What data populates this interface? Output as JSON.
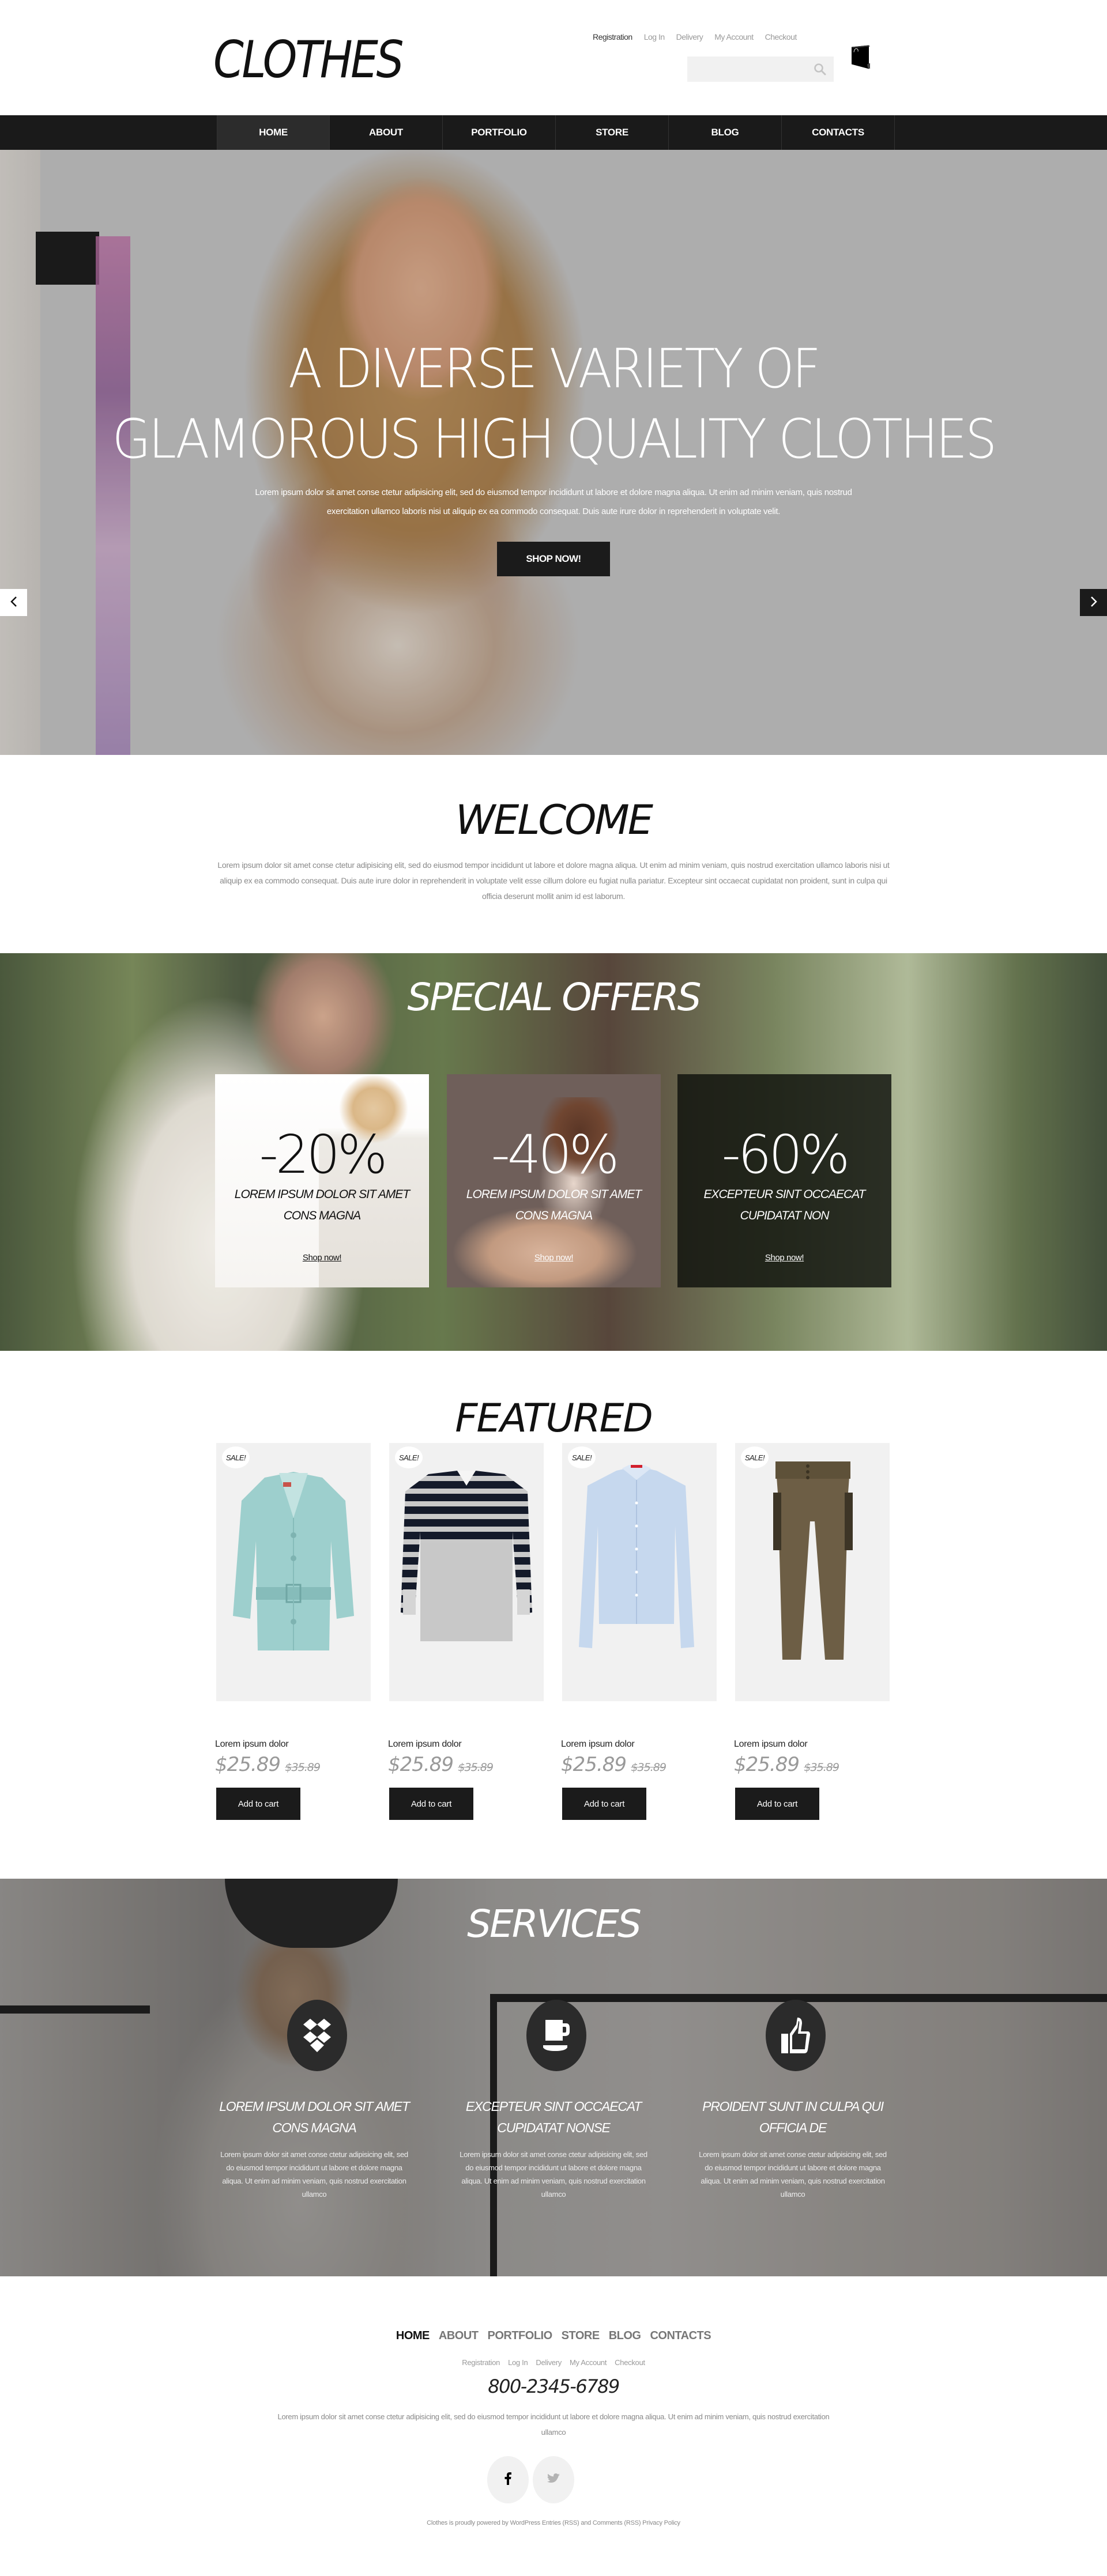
{
  "header": {
    "logo": "CLOTHES",
    "top_links": [
      "Registration",
      "Log In",
      "Delivery",
      "My Account",
      "Checkout"
    ],
    "search": {
      "placeholder": "",
      "value": "",
      "icon": "search-icon"
    },
    "cart_icon": "shopping-bag-icon"
  },
  "nav": {
    "items": [
      "HOME",
      "ABOUT",
      "PORTFOLIO",
      "STORE",
      "BLOG",
      "CONTACTS"
    ],
    "active": "HOME"
  },
  "hero": {
    "title_line1": "A DIVERSE VARIETY OF",
    "title_line2": "GLAMOROUS HIGH QUALITY CLOTHES",
    "text_line1": "Lorem ipsum dolor sit amet conse ctetur adipisicing elit, sed do eiusmod tempor incididunt ut labore et dolore magna aliqua. Ut enim ad minim veniam, quis nostrud",
    "text_line2": "exercitation ullamco laboris nisi ut aliquip ex ea commodo consequat. Duis aute irure dolor in reprehenderit in voluptate velit.",
    "button": "SHOP NOW!",
    "prev_icon": "chevron-left-icon",
    "next_icon": "chevron-right-icon"
  },
  "welcome": {
    "title": "WELCOME",
    "text": "Lorem ipsum dolor sit amet conse ctetur adipisicing elit, sed do eiusmod tempor incididunt ut labore et dolore magna aliqua. Ut enim ad minim veniam, quis nostrud exercitation ullamco laboris nisi ut aliquip ex ea commodo consequat. Duis aute irure dolor in reprehenderit in voluptate velit esse cillum dolore eu fugiat nulla pariatur. Excepteur sint occaecat cupidatat non proident, sunt in culpa qui officia deserunt mollit anim id est laborum."
  },
  "offers": {
    "title": "SPECIAL OFFERS",
    "cards": [
      {
        "percent": "-20%",
        "title": "LOREM IPSUM DOLOR SIT AMET CONS MAGNA",
        "link": "Shop now!"
      },
      {
        "percent": "-40%",
        "title": "LOREM IPSUM DOLOR SIT AMET CONS MAGNA",
        "link": "Shop now!"
      },
      {
        "percent": "-60%",
        "title": "EXCEPTEUR SINT OCCAECAT CUPIDATAT NON",
        "link": "Shop now!"
      }
    ]
  },
  "featured": {
    "title": "FEATURED",
    "products": [
      {
        "badge": "SALE!",
        "name": "Lorem ipsum dolor",
        "price": "$25.89",
        "old_price": "$35.89",
        "button": "Add to cart",
        "image": "teal trench coat"
      },
      {
        "badge": "SALE!",
        "name": "Lorem ipsum dolor",
        "price": "$25.89",
        "old_price": "$35.89",
        "button": "Add to cart",
        "image": "striped sweater"
      },
      {
        "badge": "SALE!",
        "name": "Lorem ipsum dolor",
        "price": "$25.89",
        "old_price": "$35.89",
        "button": "Add to cart",
        "image": "light blue shirt"
      },
      {
        "badge": "SALE!",
        "name": "Lorem ipsum dolor",
        "price": "$25.89",
        "old_price": "$35.89",
        "button": "Add to cart",
        "image": "olive cargo pants"
      }
    ]
  },
  "services": {
    "title": "SERVICES",
    "items": [
      {
        "icon": "dropbox-icon",
        "title": "LOREM IPSUM DOLOR SIT AMET CONS MAGNA",
        "text": "Lorem ipsum dolor sit amet conse ctetur adipisicing elit, sed do eiusmod tempor incididunt ut labore et dolore magna aliqua. Ut enim ad minim veniam, quis nostrud exercitation ullamco"
      },
      {
        "icon": "coffee-cup-icon",
        "title": "EXCEPTEUR SINT OCCAECAT CUPIDATAT NONSE",
        "text": "Lorem ipsum dolor sit amet conse ctetur adipisicing elit, sed do eiusmod tempor incididunt ut labore et dolore magna aliqua. Ut enim ad minim veniam, quis nostrud exercitation ullamco"
      },
      {
        "icon": "thumbs-up-icon",
        "title": "PROIDENT SUNT IN CULPA QUI OFFICIA DE",
        "text": "Lorem ipsum dolor sit amet conse ctetur adipisicing elit, sed do eiusmod tempor incididunt ut labore et dolore magna aliqua. Ut enim ad minim veniam, quis nostrud exercitation ullamco"
      }
    ]
  },
  "footer": {
    "nav": [
      "HOME",
      "ABOUT",
      "PORTFOLIO",
      "STORE",
      "BLOG",
      "CONTACTS"
    ],
    "links": [
      "Registration",
      "Log In",
      "Delivery",
      "My Account",
      "Checkout"
    ],
    "phone": "800-2345-6789",
    "text": "Lorem ipsum dolor sit amet conse ctetur adipisicing elit, sed do eiusmod tempor incididunt ut labore et dolore magna aliqua. Ut enim ad minim veniam, quis nostrud exercitation ullamco",
    "social": [
      "facebook-icon",
      "twitter-icon"
    ],
    "copyright": "Clothes is proudly powered by WordPress Entries (RSS) and Comments (RSS) Privacy Policy"
  },
  "colors": {
    "nav_bg": "#1a1a1a",
    "nav_active": "#2c2c2c",
    "button_bg": "#1b1b1b",
    "price": "#999999",
    "product_bg": "#f1f1f1"
  }
}
